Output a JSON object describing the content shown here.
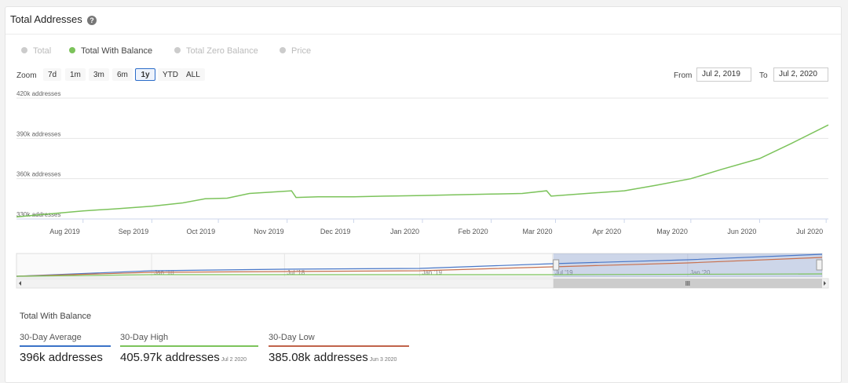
{
  "header": {
    "title": "Total Addresses",
    "help_icon": "?"
  },
  "legend": [
    {
      "label": "Total",
      "color": "#cccccc",
      "active": false
    },
    {
      "label": "Total With Balance",
      "color": "#7cc35b",
      "active": true
    },
    {
      "label": "Total Zero Balance",
      "color": "#cccccc",
      "active": false
    },
    {
      "label": "Price",
      "color": "#cccccc",
      "active": false
    }
  ],
  "zoom": {
    "label": "Zoom",
    "buttons": [
      "7d",
      "1m",
      "3m",
      "6m",
      "1y",
      "YTD",
      "ALL"
    ],
    "active": "1y"
  },
  "range": {
    "from_label": "From",
    "from_value": "Jul 2, 2019",
    "to_label": "To",
    "to_value": "Jul 2, 2020"
  },
  "chart_data": {
    "type": "line",
    "title": "",
    "series": [
      {
        "name": "Total With Balance",
        "color": "#7cc35b",
        "x": [
          "2019-07-02",
          "2019-07-15",
          "2019-08-01",
          "2019-08-15",
          "2019-09-01",
          "2019-09-15",
          "2019-09-25",
          "2019-10-05",
          "2019-10-15",
          "2019-10-25",
          "2019-11-03",
          "2019-11-05",
          "2019-11-15",
          "2019-12-01",
          "2019-12-15",
          "2020-01-01",
          "2020-01-15",
          "2020-02-01",
          "2020-02-15",
          "2020-02-26",
          "2020-02-28",
          "2020-03-15",
          "2020-04-01",
          "2020-04-15",
          "2020-05-01",
          "2020-05-15",
          "2020-06-01",
          "2020-06-15",
          "2020-07-02"
        ],
        "y": [
          331.5,
          333.5,
          336,
          337.5,
          339.5,
          342,
          345,
          345.5,
          349,
          350,
          351,
          346,
          346.5,
          346.5,
          347,
          347.5,
          348,
          348.5,
          349,
          351,
          347,
          349,
          351,
          355,
          360,
          367,
          375,
          386,
          400
        ]
      }
    ],
    "ylabel_suffix": " addresses",
    "yticks": [
      "330k addresses",
      "360k addresses",
      "390k addresses",
      "420k addresses"
    ],
    "ytick_values": [
      330,
      360,
      390,
      420
    ],
    "ylim": [
      330,
      420
    ],
    "xlim": [
      "2019-07-02",
      "2020-07-02"
    ],
    "xticks": [
      "Aug 2019",
      "Sep 2019",
      "Oct 2019",
      "Nov 2019",
      "Dec 2019",
      "Jan 2020",
      "Feb 2020",
      "Mar 2020",
      "Apr 2020",
      "May 2020",
      "Jun 2020",
      "Jul 2020"
    ],
    "xtick_dates": [
      "2019-08-01",
      "2019-09-01",
      "2019-10-01",
      "2019-11-01",
      "2019-12-01",
      "2020-01-01",
      "2020-02-01",
      "2020-03-01",
      "2020-04-01",
      "2020-05-01",
      "2020-06-01",
      "2020-07-01"
    ],
    "grid": true
  },
  "navigator": {
    "labels": [
      "Jan '18",
      "Jul '18",
      "Jan '19",
      "Jul '19",
      "Jan '20"
    ],
    "label_dates": [
      "2018-01-01",
      "2018-07-01",
      "2019-01-01",
      "2019-07-01",
      "2020-01-01"
    ],
    "start": "2017-07-01",
    "end": "2020-07-02",
    "selection_start": "2019-07-02",
    "selection_end": "2020-07-02",
    "series_colors": [
      "#4a78c8",
      "#7cc35b",
      "#c8714f"
    ]
  },
  "stats": {
    "title": "Total With Balance",
    "items": [
      {
        "label": "30-Day Average",
        "value": "396k addresses",
        "date": "",
        "color": "#3a73c8"
      },
      {
        "label": "30-Day High",
        "value": "405.97k addresses",
        "date": "Jul 2 2020",
        "color": "#7cc35b"
      },
      {
        "label": "30-Day Low",
        "value": "385.08k addresses",
        "date": "Jun 3 2020",
        "color": "#c0634a"
      }
    ]
  }
}
